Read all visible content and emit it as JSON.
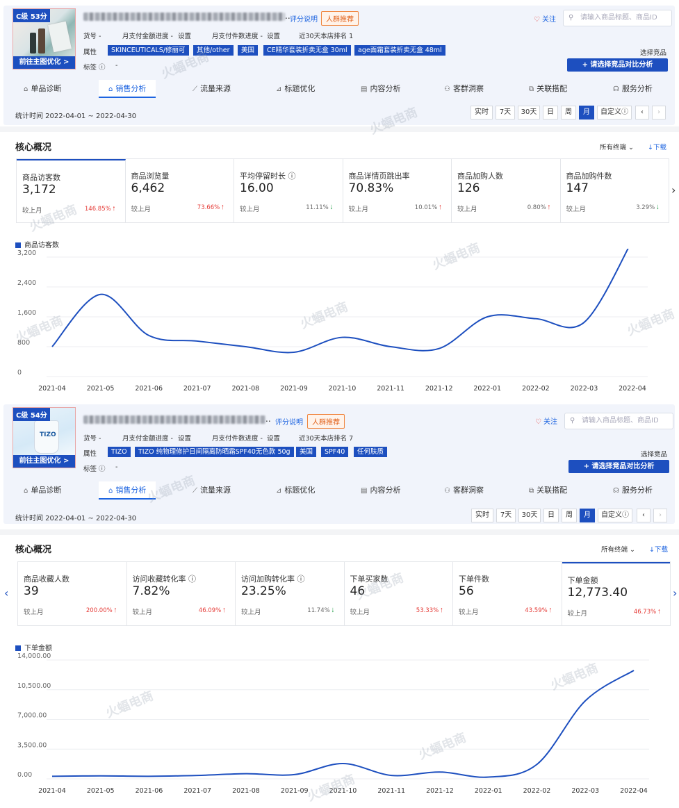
{
  "panels": [
    {
      "grade": "C级 53分",
      "thumb_button": "前往主图优化 >",
      "title_suffix": "..",
      "score_link": "评分说明",
      "crowd_tag": "人群推荐",
      "follow": "关注",
      "search_placeholder": "请输入商品标题、商品ID",
      "huohao_label": "货号 -",
      "pay_amount": "月支付金额进度 -",
      "pay_amount_set": "设置",
      "pay_count": "月支付件数进度 -",
      "pay_count_set": "设置",
      "rank": "近30天本店排名 1",
      "attr_label": "属性",
      "attrs": [
        "SKINCEUTICALS/修丽可",
        "其他/other",
        "美国",
        "CE精华套装折卖无盒 30ml",
        "age面霜套装折卖无盒 48ml"
      ],
      "tag_label": "标签 ⓘ",
      "tag_value": "-",
      "select_label": "选择竞品",
      "compare_button": "+ 请选择竞品对比分析",
      "tabs": [
        "单品诊断",
        "销售分析",
        "流量来源",
        "标题优化",
        "内容分析",
        "客群洞察",
        "关联搭配",
        "服务分析"
      ],
      "period": "统计时间 2022-04-01 ~ 2022-04-30",
      "period_buttons": [
        "实时",
        "7天",
        "30天",
        "日",
        "周",
        "月",
        "自定义ⓘ"
      ],
      "core_title": "核心概况",
      "channel": "所有终端",
      "download": "↓下载",
      "cards": [
        {
          "title": "商品访客数",
          "value": "3,172",
          "compare": "较上月",
          "pct": "146.85%",
          "dir": "up"
        },
        {
          "title": "商品浏览量",
          "value": "6,462",
          "compare": "较上月",
          "pct": "73.66%",
          "dir": "up"
        },
        {
          "title": "平均停留时长 ⓘ",
          "value": "16.00",
          "compare": "较上月",
          "pct": "11.11%",
          "dir": "down"
        },
        {
          "title": "商品详情页跳出率",
          "value": "70.83%",
          "compare": "较上月",
          "pct": "10.01%",
          "dir": "up"
        },
        {
          "title": "商品加购人数",
          "value": "126",
          "compare": "较上月",
          "pct": "0.80%",
          "dir": "up"
        },
        {
          "title": "商品加购件数",
          "value": "147",
          "compare": "较上月",
          "pct": "3.29%",
          "dir": "down"
        }
      ],
      "legend": "商品访客数"
    },
    {
      "grade": "C级 54分",
      "thumb_button": "前往主图优化 >",
      "title_suffix": "..",
      "score_link": "评分说明",
      "crowd_tag": "人群推荐",
      "follow": "关注",
      "search_placeholder": "请输入商品标题、商品ID",
      "huohao_label": "货号 -",
      "pay_amount": "月支付金额进度 -",
      "pay_amount_set": "设置",
      "pay_count": "月支付件数进度 -",
      "pay_count_set": "设置",
      "rank": "近30天本店排名 7",
      "attr_label": "属性",
      "attrs": [
        "TIZO",
        "TIZO 纯物理修护日间隔离防晒霜SPF40无色款 50g",
        "美国",
        "SPF40",
        "任何肤质"
      ],
      "tag_label": "标签 ⓘ",
      "tag_value": "-",
      "select_label": "选择竞品",
      "compare_button": "+ 请选择竞品对比分析",
      "tabs": [
        "单品诊断",
        "销售分析",
        "流量来源",
        "标题优化",
        "内容分析",
        "客群洞察",
        "关联搭配",
        "服务分析"
      ],
      "period": "统计时间 2022-04-01 ~ 2022-04-30",
      "period_buttons": [
        "实时",
        "7天",
        "30天",
        "日",
        "周",
        "月",
        "自定义ⓘ"
      ],
      "core_title": "核心概况",
      "channel": "所有终端",
      "download": "↓下载",
      "cards": [
        {
          "title": "商品收藏人数",
          "value": "39",
          "compare": "较上月",
          "pct": "200.00%",
          "dir": "up"
        },
        {
          "title": "访问收藏转化率 ⓘ",
          "value": "7.82%",
          "compare": "较上月",
          "pct": "46.09%",
          "dir": "up"
        },
        {
          "title": "访问加购转化率 ⓘ",
          "value": "23.25%",
          "compare": "较上月",
          "pct": "11.74%",
          "dir": "down"
        },
        {
          "title": "下单买家数",
          "value": "46",
          "compare": "较上月",
          "pct": "53.33%",
          "dir": "up"
        },
        {
          "title": "下单件数",
          "value": "56",
          "compare": "较上月",
          "pct": "43.59%",
          "dir": "up"
        },
        {
          "title": "下单金额",
          "value": "12,773.40",
          "compare": "较上月",
          "pct": "46.73%",
          "dir": "up"
        }
      ],
      "legend": "下单金额"
    }
  ],
  "chart_data": [
    {
      "type": "line",
      "series": [
        {
          "name": "商品访客数",
          "values": [
            800,
            2200,
            1100,
            950,
            800,
            650,
            1050,
            800,
            750,
            1600,
            1550,
            1450,
            3650
          ]
        }
      ],
      "categories": [
        "2021-04",
        "2021-05",
        "2021-06",
        "2021-07",
        "2021-08",
        "2021-09",
        "2021-10",
        "2021-11",
        "2021-12",
        "2022-01",
        "2022-02",
        "2022-03",
        "2022-04"
      ],
      "yticks": [
        "0",
        "800",
        "1,600",
        "2,400",
        "3,200"
      ],
      "ylim": [
        0,
        3200
      ],
      "color": "#1d4fbf"
    },
    {
      "type": "line",
      "series": [
        {
          "name": "下单金额",
          "values": [
            300,
            350,
            300,
            400,
            600,
            500,
            1800,
            400,
            800,
            200,
            1700,
            9200,
            12773.4
          ]
        }
      ],
      "categories": [
        "2021-04",
        "2021-05",
        "2021-06",
        "2021-07",
        "2021-08",
        "2021-09",
        "2021-10",
        "2021-11",
        "2021-12",
        "2022-01",
        "2022-02",
        "2022-03",
        "2022-04"
      ],
      "yticks": [
        "0.00",
        "3,500.00",
        "7,000.00",
        "10,500.00",
        "14,000.00"
      ],
      "ylim": [
        0,
        14000
      ],
      "color": "#1d4fbf"
    }
  ],
  "watermark": "火蝠电商"
}
